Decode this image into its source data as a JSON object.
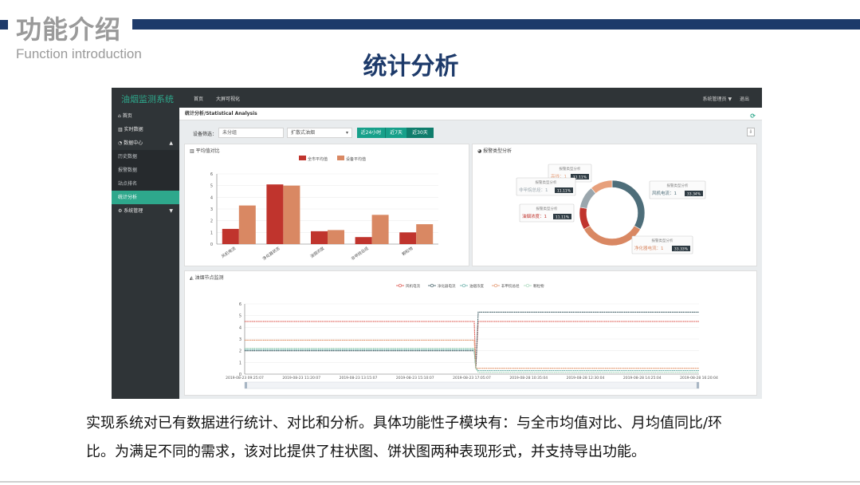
{
  "slide": {
    "title": "功能介绍",
    "subtitle": "Function introduction",
    "center_title": "统计分析",
    "caption_line1": "实现系统对已有数据进行统计、对比和分析。具体功能性子模块有：与全市均值对比、月均值同比/环",
    "caption_line2": "比。为满足不同的需求，该对比提供了柱状图、饼状图两种表现形式，并支持导出功能。",
    "accent_color": "#1d3a6a"
  },
  "app": {
    "brand": "油烟监测系统",
    "tabs": [
      "首页",
      "大屏可视化"
    ],
    "user": "系统管理员 ▼",
    "logout": "退出",
    "sidebar": {
      "home": "首页",
      "realtime": "实时数据",
      "data_center": "数据中心",
      "history": "历史数据",
      "alarm": "报警数据",
      "site_rank": "站点排名",
      "stats": "统计分析",
      "system": "系统管理"
    },
    "breadcrumb": "统计分析/Statistical Analysis",
    "filter": {
      "label": "设备筛选：",
      "group": "未分组",
      "device": "扩散式油烟",
      "btn_24h": "近24小时",
      "btn_7d": "近7天",
      "btn_30d": "近30天"
    },
    "icons": [
      "refresh-icon",
      "export-icon",
      "home-icon",
      "chart-icon",
      "gear-icon",
      "chevron-down-icon",
      "pie-icon",
      "area-chart-icon"
    ],
    "colors": {
      "teal": "#2ea88c",
      "city_avg": "#c0342d",
      "device_avg": "#d98863"
    }
  },
  "chart_data": [
    {
      "type": "bar",
      "title": "平均值对比",
      "categories": [
        "风机电流",
        "净化器状态",
        "油烟浓度",
        "非甲烷总烃",
        "颗粒物"
      ],
      "series": [
        {
          "name": "全市平均值",
          "values": [
            1.3,
            5.1,
            1.1,
            0.6,
            1.0
          ]
        },
        {
          "name": "设备平均值",
          "values": [
            3.3,
            5.0,
            1.2,
            2.5,
            1.7
          ]
        }
      ],
      "yticks": [
        "0",
        "1",
        "2",
        "3",
        "4",
        "5",
        "6"
      ],
      "ylim": [
        0,
        6
      ],
      "legend": "top"
    },
    {
      "type": "pie",
      "title": "报警类型分析",
      "tooltip_title": "报警类型分析",
      "slices": [
        {
          "label": "风机电流",
          "count": "1",
          "percent": "33.34%",
          "value": 33.34,
          "color": "#4e6e7a"
        },
        {
          "label": "净化器电流",
          "count": "1",
          "percent": "33.33%",
          "value": 33.33,
          "color": "#d98863"
        },
        {
          "label": "油烟浓度",
          "count": "1",
          "percent": "11.11%",
          "value": 11.11,
          "color": "#c0342d"
        },
        {
          "label": "非甲烷总烃",
          "count": "1",
          "percent": "11.11%",
          "value": 11.11,
          "color": "#9aa6ad"
        },
        {
          "label": "高线",
          "count": "1",
          "percent": "11.11%",
          "value": 11.11,
          "color": "#e7a07c"
        }
      ]
    },
    {
      "type": "line",
      "title": "油烟节点监测",
      "legend": [
        "风机电流",
        "净化器电流",
        "油烟浓度",
        "非甲烷总烃",
        "颗粒物"
      ],
      "colors": [
        "#d9433a",
        "#2f4f57",
        "#5aa7a0",
        "#e0895c",
        "#9fd4b5"
      ],
      "yticks": [
        "0",
        "1",
        "2",
        "3",
        "4",
        "5",
        "6"
      ],
      "ylim": [
        0,
        6
      ],
      "x": [
        "2019-08-23 09:25:07",
        "2019-08-23 11:20:07",
        "2019-08-23 13:15:07",
        "2019-08-23 15:10:07",
        "2019-08-23 17:05:07",
        "2019-08-28 10:35:04",
        "2019-08-28 12:30:04",
        "2019-08-28 14:25:04",
        "2019-08-28 16:20:04"
      ],
      "series": [
        {
          "name": "风机电流",
          "before": 4.5,
          "after": 4.5
        },
        {
          "name": "净化器电流",
          "before": 2.0,
          "after": 5.3
        },
        {
          "name": "油烟浓度",
          "before": 2.1,
          "after": 0.3
        },
        {
          "name": "非甲烷总烃",
          "before": 2.9,
          "after": 0.5
        },
        {
          "name": "颗粒物",
          "before": 2.2,
          "after": 0.15
        }
      ]
    }
  ]
}
